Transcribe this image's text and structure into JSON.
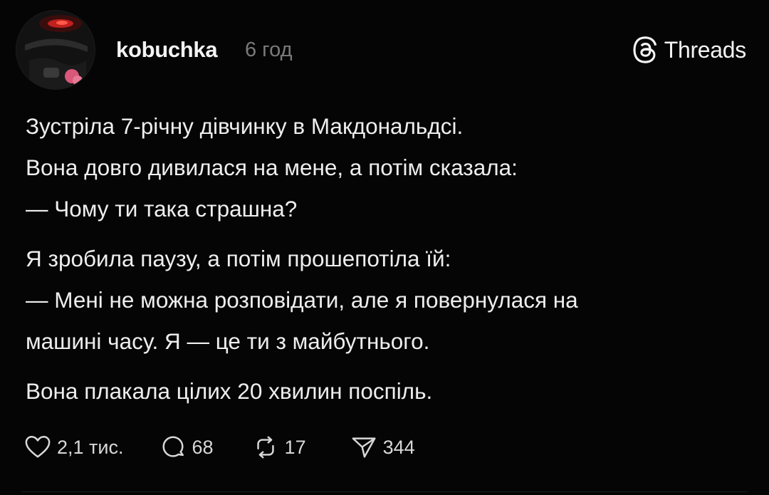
{
  "post": {
    "author": "kobuchka",
    "time": "6 год",
    "brand": {
      "name": "Threads",
      "icon": "threads-logo-icon"
    },
    "paragraphs": [
      {
        "lines": [
          "Зустріла 7-річну дівчинку в Макдональдсі.",
          "Вона довго дивилася на мене, а потім сказала:",
          "— Чому ти така страшна?"
        ]
      },
      {
        "lines": [
          "Я зробила паузу, а потім прошепотіла їй:",
          "— Мені не можна розповідати, але я повернулася на",
          "машині часу. Я — це ти з майбутнього."
        ]
      },
      {
        "lines": [
          "Вона плакала цілих 20 хвилин поспіль."
        ]
      }
    ],
    "actions": {
      "likes": {
        "icon": "heart-icon",
        "count": "2,1 тис."
      },
      "replies": {
        "icon": "comment-icon",
        "count": "68"
      },
      "reposts": {
        "icon": "repost-icon",
        "count": "17"
      },
      "shares": {
        "icon": "send-icon",
        "count": "344"
      }
    }
  }
}
